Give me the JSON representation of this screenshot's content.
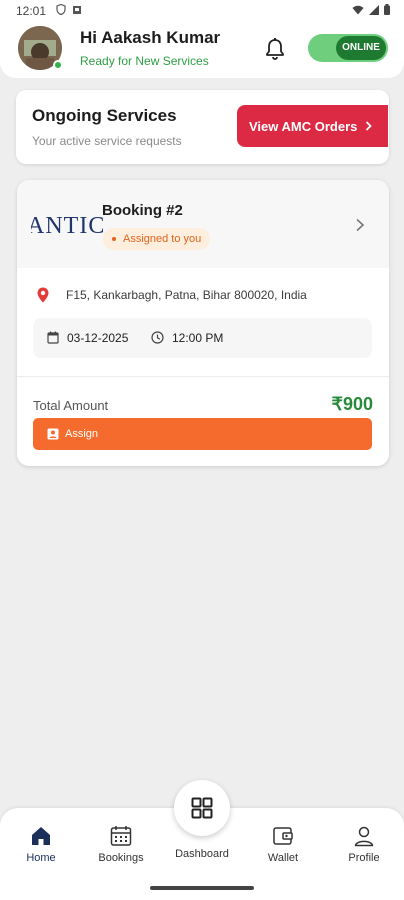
{
  "status_bar": {
    "time": "12:01"
  },
  "header": {
    "greeting": "Hi Aakash Kumar",
    "subtitle": "Ready for New Services",
    "toggle_label": "ONLINE"
  },
  "ongoing": {
    "title": "Ongoing Services",
    "subtitle": "Your active service requests",
    "amc_button": "View AMC Orders"
  },
  "booking": {
    "logo_text": "ANTIC",
    "title": "Booking #2",
    "status": "Assigned to you",
    "address": "F15, Kankarbagh, Patna, Bihar 800020, India",
    "date": "03-12-2025",
    "time": "12:00 PM",
    "total_label": "Total Amount",
    "total_value": "₹900",
    "assign_label": "Assign"
  },
  "bottom_nav": {
    "items": [
      {
        "label": "Home",
        "icon": "home-icon"
      },
      {
        "label": "Bookings",
        "icon": "calendar-icon"
      },
      {
        "label": "Dashboard",
        "icon": "grid-icon"
      },
      {
        "label": "Wallet",
        "icon": "wallet-icon"
      },
      {
        "label": "Profile",
        "icon": "person-icon"
      }
    ]
  },
  "colors": {
    "online_green": "#1f7a31",
    "amc_red": "#dd2a44",
    "assign_orange": "#f46b2d",
    "amount_green": "#2a8a3c",
    "nav_active": "#1b2f5a"
  }
}
